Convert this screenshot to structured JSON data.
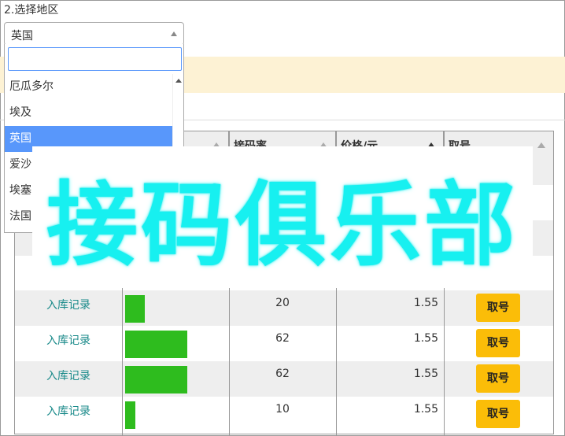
{
  "form": {
    "step_label": "2.选择地区",
    "region_select": {
      "selected": "英国"
    }
  },
  "dropdown": {
    "search_value": "",
    "options": [
      "厄瓜多尔",
      "埃及",
      "英国",
      "爱沙",
      "埃塞",
      "法国"
    ],
    "selected_index": 2
  },
  "table": {
    "headers": [
      "",
      "",
      "接码率",
      "价格/元",
      "取号"
    ],
    "rows": [
      {
        "record": "入库记录",
        "bar_fraction": 0.32,
        "rate": "20",
        "price": "1.55",
        "action": "取号"
      },
      {
        "record": "入库记录",
        "bar_fraction": 1.0,
        "rate": "62",
        "price": "1.55",
        "action": "取号"
      },
      {
        "record": "入库记录",
        "bar_fraction": 1.0,
        "rate": "62",
        "price": "1.55",
        "action": "取号"
      },
      {
        "record": "入库记录",
        "bar_fraction": 0.16,
        "rate": "10",
        "price": "1.55",
        "action": "取号"
      }
    ]
  },
  "watermark": {
    "text": "接码俱乐部"
  },
  "colors": {
    "accent_blue": "#5897fb",
    "bar_green": "#2ebc1e",
    "button_yellow": "#fbbd08",
    "link_teal": "#1a8a8a",
    "watermark_cyan": "#17f0f0",
    "banner": "#fdf2d4"
  }
}
